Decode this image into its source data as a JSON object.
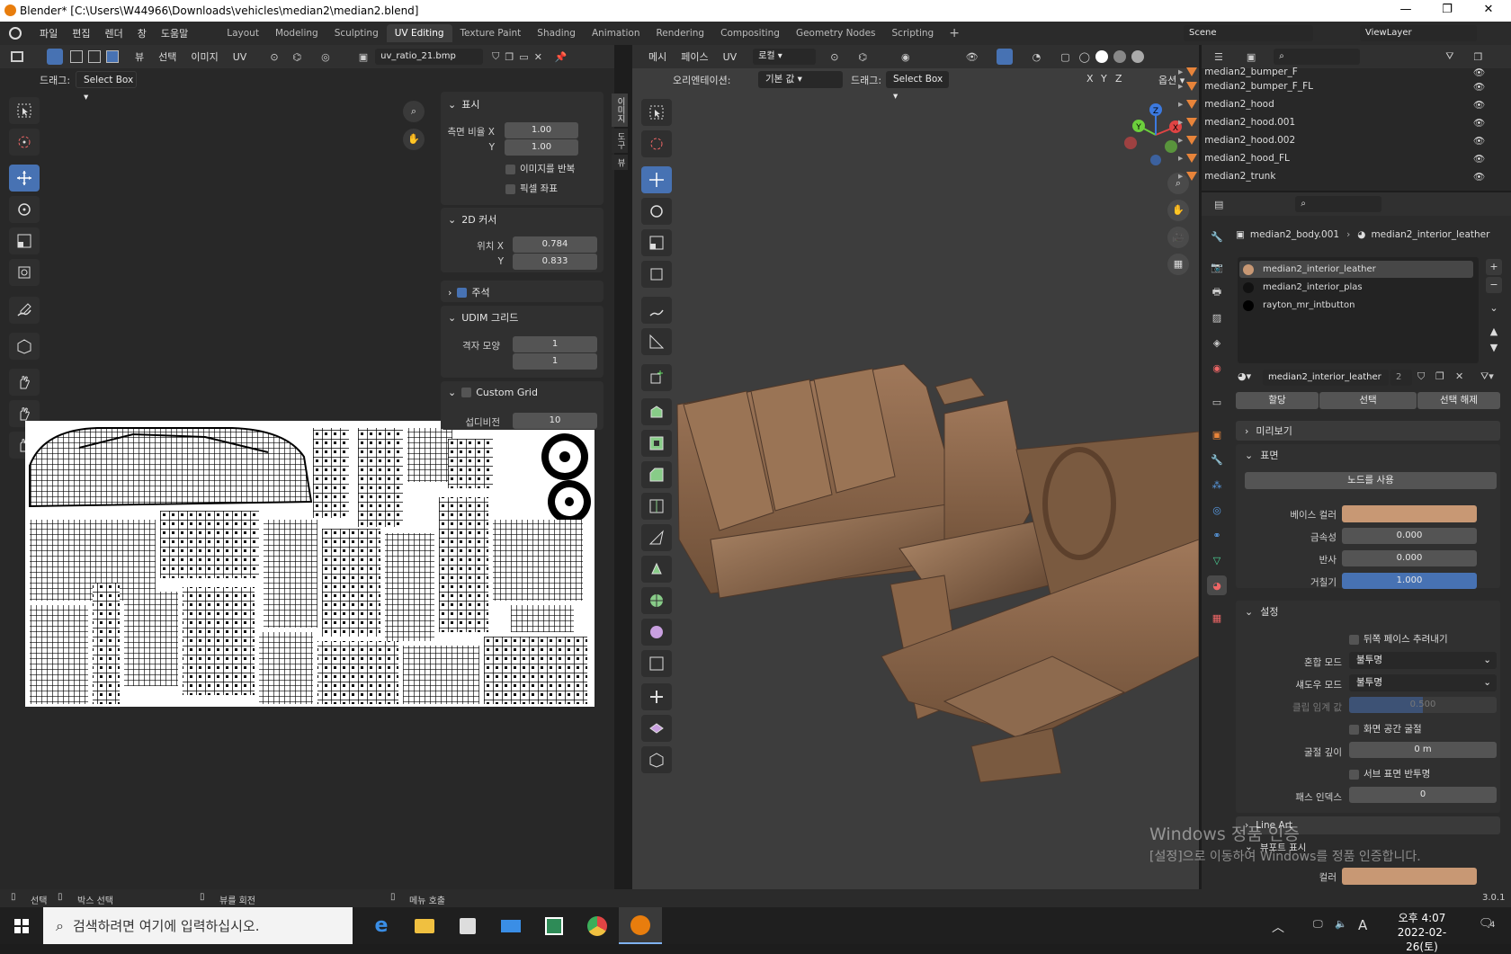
{
  "window": {
    "title": "Blender* [C:\\Users\\W44966\\Downloads\\vehicles\\median2\\median2.blend]",
    "minimize": "—",
    "maximize": "❐",
    "close": "✕"
  },
  "menu": [
    "파일",
    "편집",
    "렌더",
    "창",
    "도움말"
  ],
  "workspaces": [
    "Layout",
    "Modeling",
    "Sculpting",
    "UV Editing",
    "Texture Paint",
    "Shading",
    "Animation",
    "Rendering",
    "Compositing",
    "Geometry Nodes",
    "Scripting"
  ],
  "workspace_add": "+",
  "scene": {
    "name": "Scene",
    "view_layer": "ViewLayer"
  },
  "uv_editor": {
    "header_menus": [
      "뷰",
      "선택",
      "이미지",
      "UV"
    ],
    "image_name": "uv_ratio_21.bmp",
    "drag_label": "드래그:",
    "drag_value": "Select Box",
    "side_tabs": [
      "이미지",
      "도구",
      "뷰"
    ],
    "display_panel": {
      "title": "표시",
      "aspect_x_label": "측면 비율 X",
      "aspect_x": "1.00",
      "aspect_y_label": "Y",
      "aspect_y": "1.00",
      "repeat_image": "이미지를 반복",
      "pixel_coords": "픽셀 좌표"
    },
    "cursor_panel": {
      "title": "2D 커서",
      "loc_x_label": "위치 X",
      "loc_x": "0.784",
      "loc_y_label": "Y",
      "loc_y": "0.833"
    },
    "annotation_panel": {
      "title": "주석"
    },
    "udim_panel": {
      "title": "UDIM 그리드",
      "grid_shape_label": "격자 모양",
      "grid_x": "1",
      "grid_y": "1"
    },
    "custom_grid_panel": {
      "title": "Custom Grid",
      "subdiv_label": "섭디비전",
      "subdiv": "10"
    }
  },
  "viewport": {
    "header_menus": [
      "메시",
      "페이스",
      "UV"
    ],
    "transform_space": "로컬",
    "orientation_label": "오리엔테이션:",
    "orientation_value": "기본 값",
    "drag_label": "드래그:",
    "drag_value": "Select Box",
    "axes": [
      "X",
      "Y",
      "Z"
    ],
    "options_label": "옵션",
    "gizmo": {
      "x": "X",
      "y": "Y",
      "z": "Z"
    }
  },
  "outliner": {
    "items": [
      "median2_bumper_F",
      "median2_bumper_F_FL",
      "median2_hood",
      "median2_hood.001",
      "median2_hood.002",
      "median2_hood_FL",
      "median2_trunk"
    ]
  },
  "properties": {
    "breadcrumb_object": "median2_body.001",
    "breadcrumb_material": "median2_interior_leather",
    "material_slots": [
      "median2_interior_leather",
      "median2_interior_plas",
      "rayton_mr_intbutton"
    ],
    "material_name": "median2_interior_leather",
    "user_count": "2",
    "assign": "할당",
    "select": "선택",
    "deselect": "선택 해제",
    "preview_panel": "미리보기",
    "surface_panel": "표면",
    "use_nodes": "노드를 사용",
    "base_color_label": "베이스 컬러",
    "base_color": "#c89874",
    "metallic_label": "금속성",
    "metallic": "0.000",
    "specular_label": "반사",
    "specular": "0.000",
    "roughness_label": "거칠기",
    "roughness": "1.000",
    "settings_panel": "설정",
    "backface_culling": "뒤쪽 페이스 추려내기",
    "blend_mode_label": "혼합 모드",
    "blend_mode": "불투명",
    "shadow_mode_label": "섀도우 모드",
    "shadow_mode": "불투명",
    "clip_threshold_label": "클립 임계 값",
    "clip_threshold": "0.500",
    "screen_space_refraction": "화면 공간 굴절",
    "refraction_depth_label": "굴절 깊이",
    "refraction_depth": "0 m",
    "subsurface_translucency": "서브 표면 반투명",
    "pass_index_label": "패스 인덱스",
    "pass_index": "0",
    "line_art_panel": "Line Art",
    "viewport_display_panel": "뷰포트 표시",
    "color_label": "컬러"
  },
  "watermark": {
    "line1": "Windows 정품 인증",
    "line2": "[설정]으로 이동하여 Windows를 정품 인증합니다."
  },
  "statusbar": {
    "select": "선택",
    "box_select": "박스 선택",
    "rotate_view": "뷰를 회전",
    "call_menu": "메뉴 호출",
    "version": "3.0.1"
  },
  "taskbar": {
    "search_placeholder": "검색하려면 여기에 입력하십시오.",
    "time": "오후 4:07",
    "date": "2022-02-26(토)",
    "ime": "A",
    "notification_count": "4"
  }
}
